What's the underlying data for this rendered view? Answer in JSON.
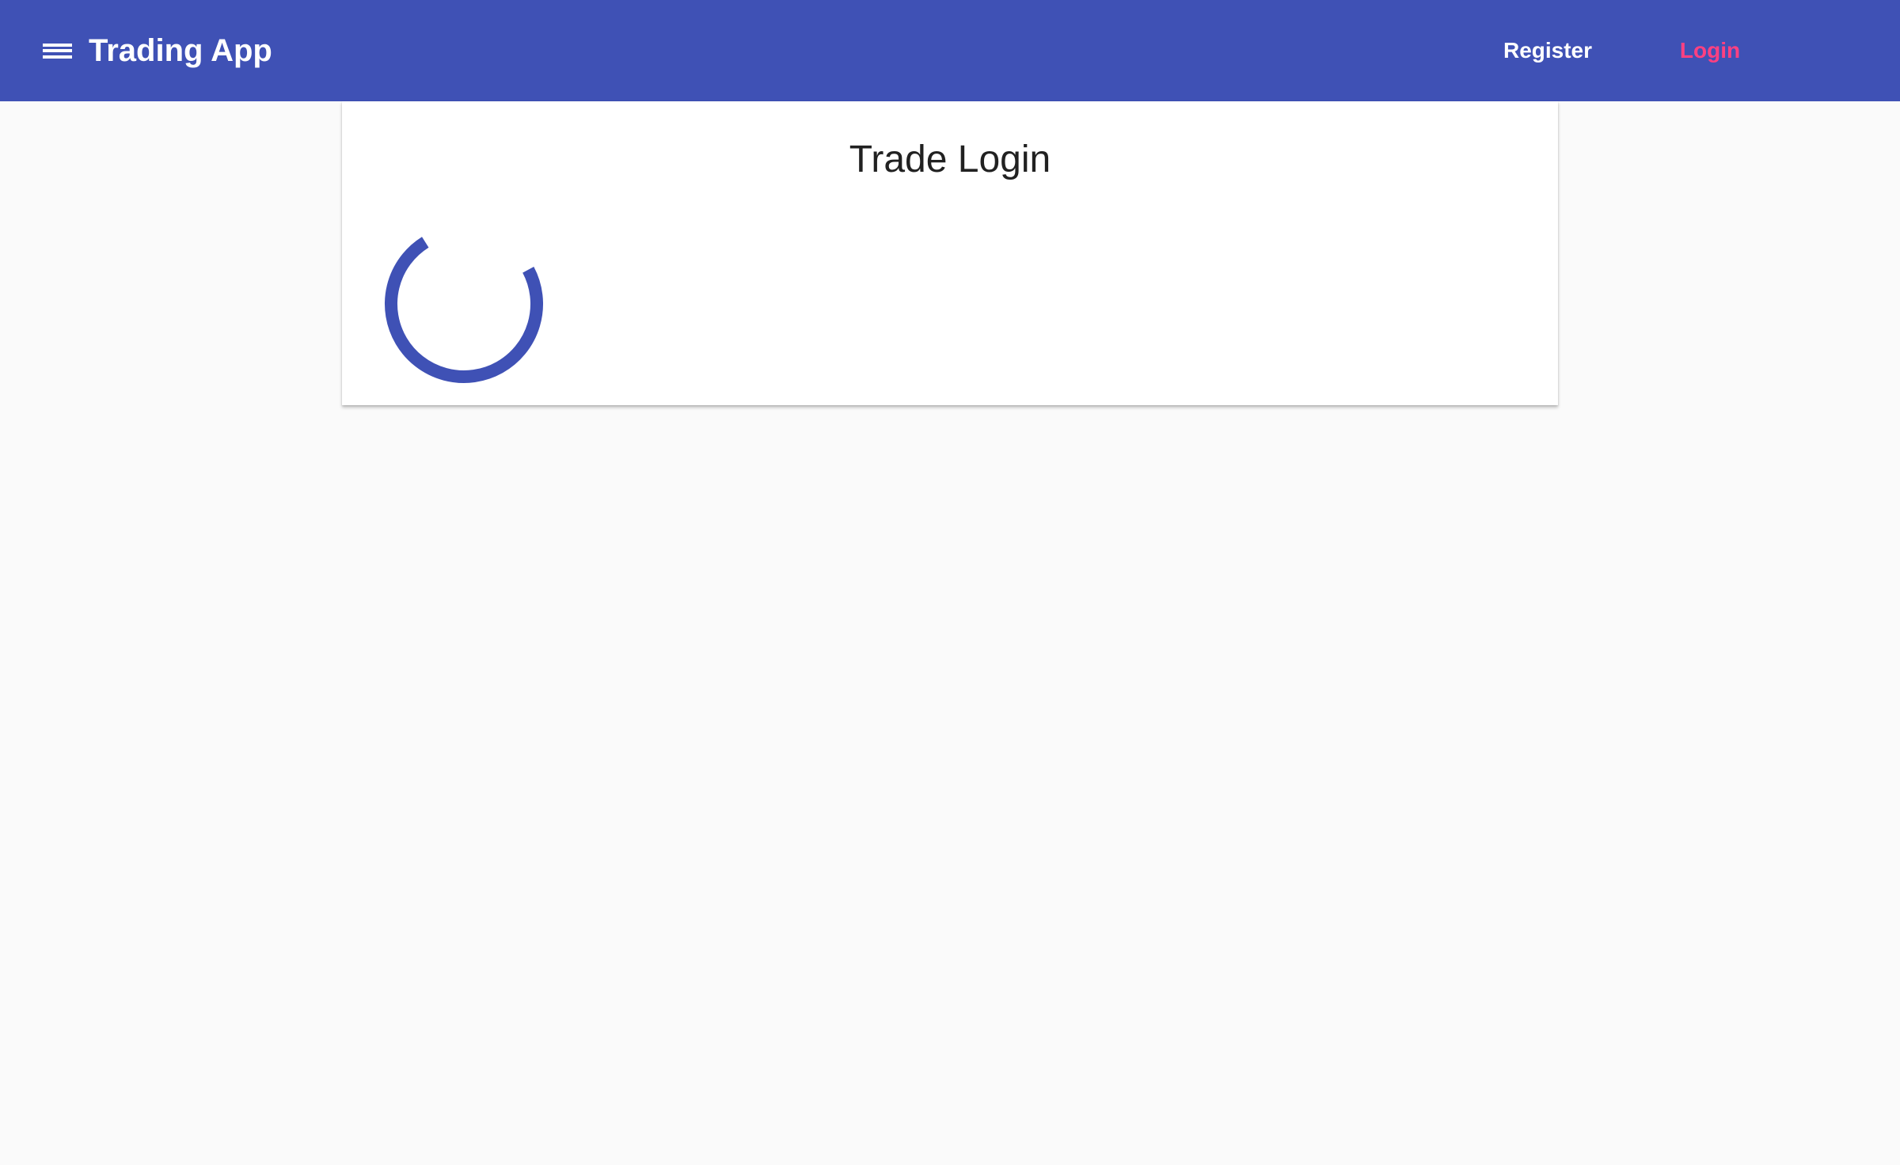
{
  "toolbar": {
    "title": "Trading App",
    "menu_icon": "menu-icon",
    "register_label": "Register",
    "login_label": "Login",
    "background_color": "#3f51b5",
    "login_color": "#ff4081"
  },
  "card": {
    "title": "Trade Login",
    "spinner_color": "#3f51b5"
  }
}
